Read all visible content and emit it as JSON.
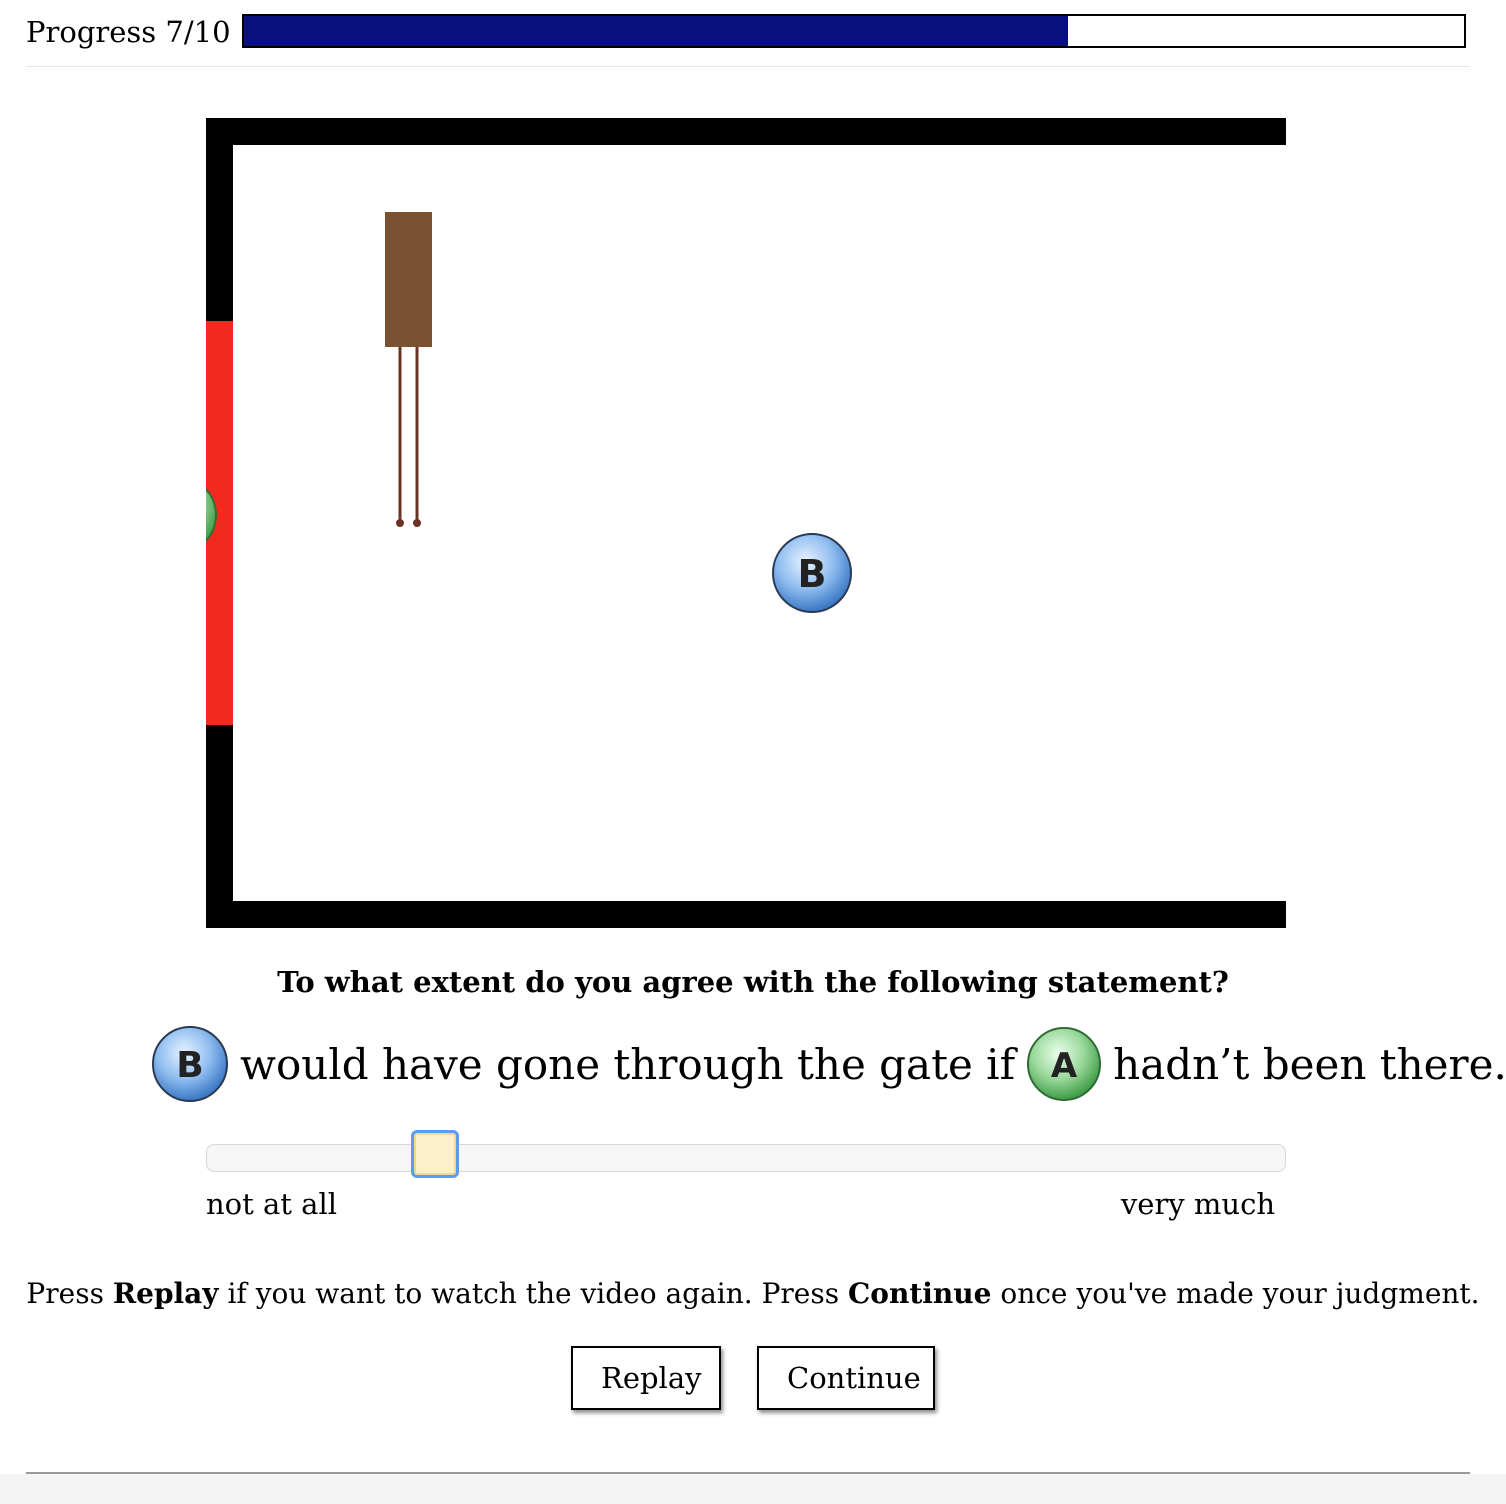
{
  "progress": {
    "label": "Progress 7/10",
    "current": 7,
    "total": 10,
    "fraction": 0.675,
    "fill_color": "#08117f"
  },
  "scene": {
    "wall_color": "#000000",
    "gate_color": "#f22a1e",
    "block_color": "#7a5131",
    "ball_b": {
      "label": "B",
      "color": "#4a8fd6"
    },
    "ball_a": {
      "label": "A",
      "color": "#5fbf63"
    }
  },
  "question": {
    "prompt": "To what extent do you agree with the following statement?",
    "statement": {
      "subject_ball": "B",
      "middle_text": "would have gone through the gate if",
      "object_ball": "A",
      "end_text": "hadn’t been there."
    }
  },
  "slider": {
    "value": 0.212,
    "min_label": "not at all",
    "max_label": "very much"
  },
  "instructions": {
    "part1": "Press ",
    "replay_word": "Replay",
    "part2": " if you want to watch the video again. Press ",
    "continue_word": "Continue",
    "part3": " once you've made your judgment."
  },
  "buttons": {
    "replay": "Replay",
    "continue": "Continue"
  }
}
